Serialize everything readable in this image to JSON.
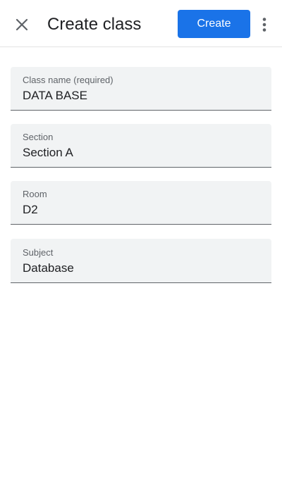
{
  "header": {
    "close_icon": "close-icon",
    "title": "Create class",
    "create_label": "Create",
    "more_icon": "more-vert-icon",
    "accent_color": "#1a73e8"
  },
  "form": {
    "fields": [
      {
        "label": "Class name (required)",
        "value": "DATA BASE"
      },
      {
        "label": "Section",
        "value": "Section A"
      },
      {
        "label": "Room",
        "value": "D2"
      },
      {
        "label": "Subject",
        "value": "Database"
      }
    ]
  }
}
